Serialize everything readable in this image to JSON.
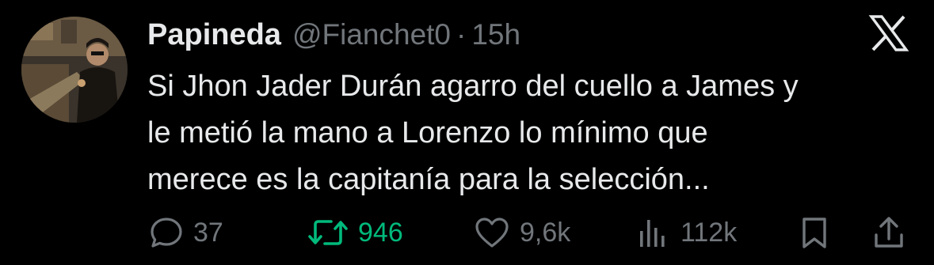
{
  "tweet": {
    "author": {
      "display_name": "Papineda",
      "handle": "@Fianchet0",
      "separator": "·",
      "time": "15h"
    },
    "text_lines": [
      "Si Jhon Jader Durán agarro del cuello a James y",
      "le metió la mano a Lorenzo lo mínimo que",
      "merece es la capitanía para la selección..."
    ],
    "actions": {
      "replies": "37",
      "retweets": "946",
      "likes": "9,6k",
      "views": "112k"
    },
    "icons": {
      "platform": "x-logo-icon",
      "reply": "speech-bubble-icon",
      "retweet": "repost-arrows-icon",
      "like": "heart-icon",
      "views": "bar-chart-icon",
      "bookmark": "bookmark-icon",
      "share": "share-upload-icon"
    }
  },
  "colors": {
    "background": "#000000",
    "primary_text": "#e7e9ea",
    "secondary_text": "#71767b",
    "retweet_active": "#00ba7c"
  }
}
